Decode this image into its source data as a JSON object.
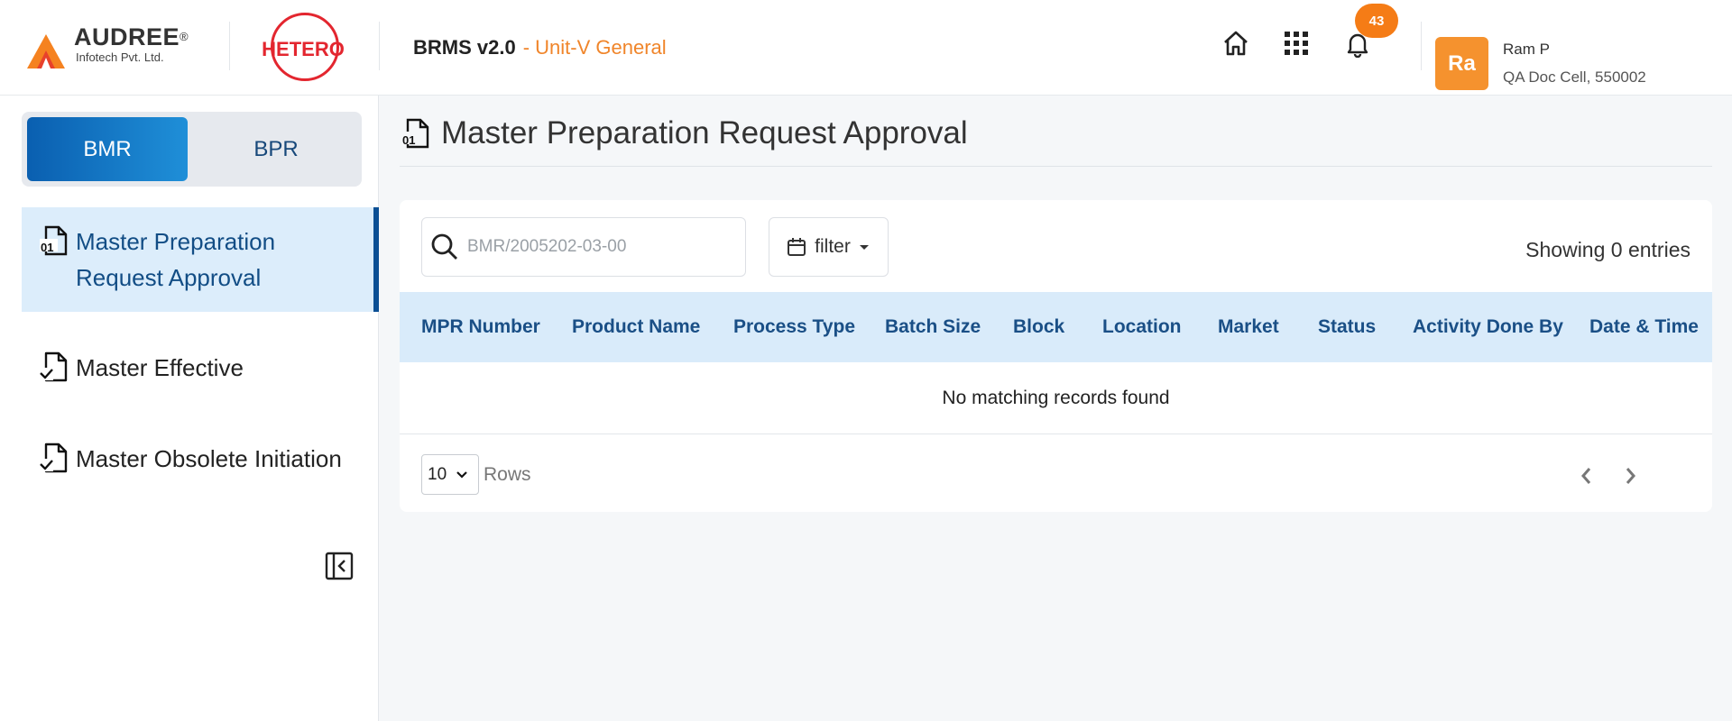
{
  "header": {
    "brand": {
      "name": "AUDREE",
      "reg": "®",
      "sub": "Infotech Pvt. Ltd."
    },
    "client": {
      "name": "HETERO"
    },
    "app_title": "BRMS v2.0",
    "unit": "- Unit-V General",
    "notification_count": "43",
    "user": {
      "initials": "Ra",
      "name": "Ram P",
      "role": "QA Doc Cell, 550002"
    },
    "icons": [
      "home-icon",
      "apps-grid-icon",
      "bell-icon"
    ],
    "accent_color": "#f0852a"
  },
  "sidebar": {
    "toggle": {
      "active": "BMR",
      "inactive": "BPR"
    },
    "items": [
      {
        "line1": "Master Preparation",
        "line2": "Request Approval",
        "icon": "file-binary-icon",
        "active": true
      },
      {
        "label": "Master Effective",
        "icon": "file-check-icon"
      },
      {
        "label": "Master Obsolete Initiation",
        "icon": "file-check-icon"
      }
    ]
  },
  "main": {
    "title": "Master Preparation Request Approval",
    "search_placeholder": "BMR/2005202-03-00",
    "filter_label": "filter",
    "entries_text": "Showing 0 entries",
    "columns": [
      "MPR Number",
      "Product Name",
      "Process Type",
      "Batch Size",
      "Block",
      "Location",
      "Market",
      "Status",
      "Activity Done By",
      "Date & Time"
    ],
    "empty_message": "No matching records found",
    "rows_value": "10",
    "rows_label": "Rows",
    "header_bg": "#d9ebfa"
  }
}
